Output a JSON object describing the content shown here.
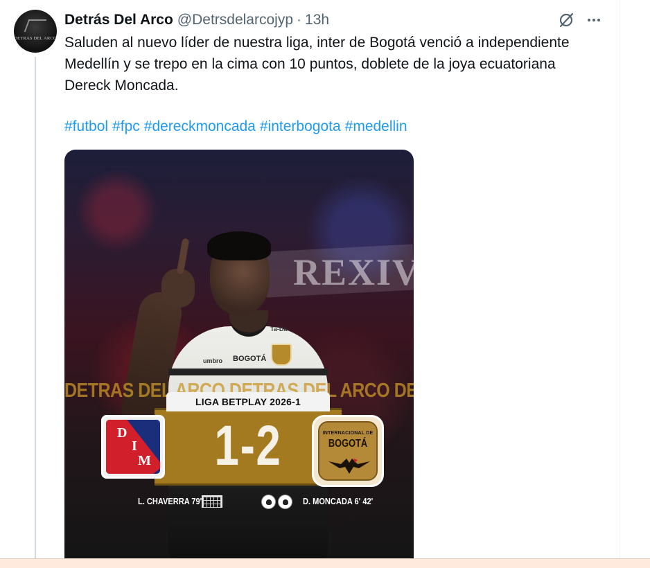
{
  "tweet": {
    "display_name": "Detrás Del Arco",
    "handle": "@Detrsdelarcojyp",
    "separator": "·",
    "time": "13h",
    "text": "Saluden al nuevo líder de nuestra liga, inter de Bogotá venció a independiente Medellín y se trepo en la cima con 10 puntos, doblete de la joya ecuatoriana Dereck Moncada.",
    "hashtags": [
      "#futbol",
      "#fpc",
      "#dereckmoncada",
      "#interbogota",
      "#medellin"
    ],
    "avatar_text": "DETRAS DEL ARCO"
  },
  "media": {
    "banner_text": "REXIV",
    "jersey_brand": "BOGOTÁ",
    "jersey_maker": "umbro",
    "jersey_sponsor": "Ta-Da",
    "watermark": "DETRAS DEL ARCO DETRAS DEL ARCO DETRAS DEL ARCO",
    "league": "LIGA BETPLAY 2026-1",
    "score": "1-2",
    "home_crest_letters": [
      "D",
      "I",
      "M"
    ],
    "away_crest_top": "INTERNACIONAL DE",
    "away_crest_name": "BOGOTÁ",
    "home_scorers": "L. CHAVERRA 79'",
    "away_scorers": "D. MONCADA 6' 42'"
  },
  "icons": {
    "grok": "grok-icon",
    "more": "more-icon",
    "goal": "goal-net-icon",
    "ball": "soccer-ball-icon"
  },
  "colors": {
    "hashtag": "#1d9bf0",
    "secondary_text": "#536471",
    "score_plate": "#a47a21"
  }
}
